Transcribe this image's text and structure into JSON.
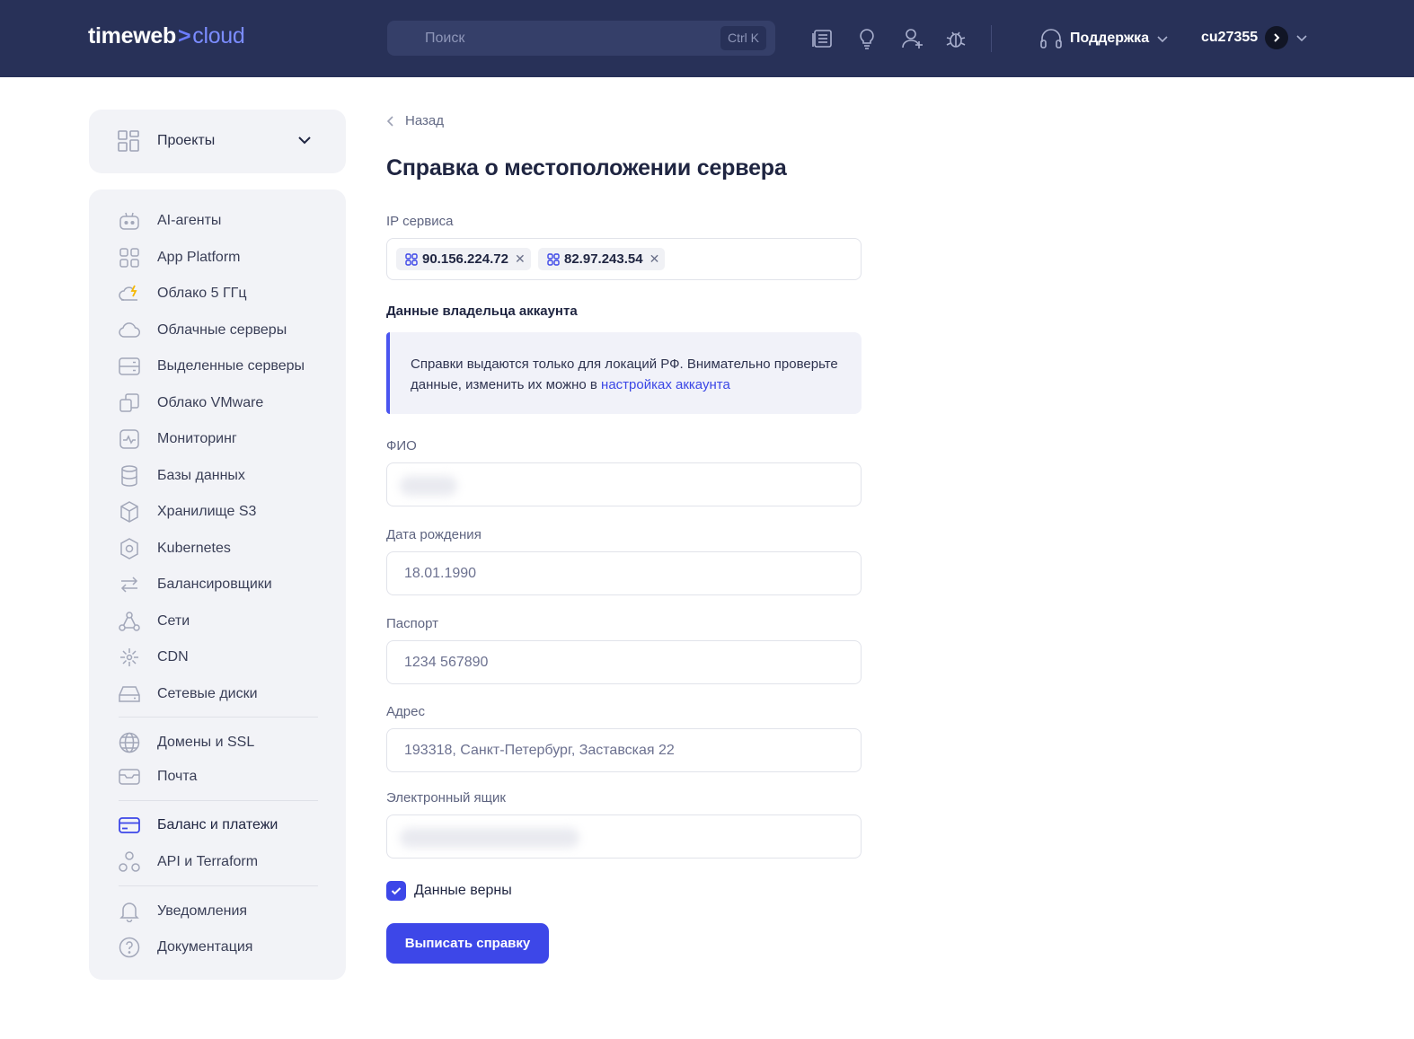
{
  "header": {
    "logo_main": "timeweb",
    "logo_arrow": ">",
    "logo_accent": "cloud",
    "search_placeholder": "Поиск",
    "search_shortcut": "Ctrl K",
    "icons": [
      "news-icon",
      "lightbulb-icon",
      "add-user-icon",
      "bug-icon"
    ],
    "support_label": "Поддержка",
    "user_name": "cu27355"
  },
  "sidebar": {
    "projects_label": "Проекты",
    "items": [
      {
        "label": "AI-агенты",
        "icon": "robot-icon"
      },
      {
        "label": "App Platform",
        "icon": "grid-icon"
      },
      {
        "label": "Облако 5 ГГц",
        "icon": "cloud-bolt-icon"
      },
      {
        "label": "Облачные серверы",
        "icon": "cloud-icon"
      },
      {
        "label": "Выделенные серверы",
        "icon": "server-icon"
      },
      {
        "label": "Облако VMware",
        "icon": "vmware-icon"
      },
      {
        "label": "Мониторинг",
        "icon": "monitoring-icon"
      },
      {
        "label": "Базы данных",
        "icon": "database-icon"
      },
      {
        "label": "Хранилище S3",
        "icon": "cube-icon"
      },
      {
        "label": "Kubernetes",
        "icon": "kubernetes-icon"
      },
      {
        "label": "Балансировщики",
        "icon": "balancer-icon"
      },
      {
        "label": "Сети",
        "icon": "network-icon"
      },
      {
        "label": "CDN",
        "icon": "cdn-icon"
      },
      {
        "label": "Сетевые диски",
        "icon": "disk-icon"
      },
      {
        "label": "Домены и SSL",
        "icon": "globe-icon"
      },
      {
        "label": "Почта",
        "icon": "mail-icon"
      },
      {
        "label": "Баланс и платежи",
        "icon": "card-icon"
      },
      {
        "label": "API и Terraform",
        "icon": "api-icon"
      },
      {
        "label": "Уведомления",
        "icon": "bell-icon"
      },
      {
        "label": "Документация",
        "icon": "help-icon"
      }
    ]
  },
  "main": {
    "back_label": "Назад",
    "title": "Справка о местоположении сервера",
    "ip_label": "IP сервиса",
    "ips": [
      "90.156.224.72",
      "82.97.243.54"
    ],
    "owner_section": "Данные владельца аккаунта",
    "notice_text": "Справки выдаются только для локаций РФ. Внимательно проверьте данные, изменить их можно в ",
    "notice_link": "настройках аккаунта",
    "fio_label": "ФИО",
    "birth_label": "Дата рождения",
    "birth_value": "18.01.1990",
    "passport_label": "Паспорт",
    "passport_value": "1234 567890",
    "address_label": "Адрес",
    "address_value": "193318, Санкт-Петербург, Заставская 22",
    "email_label": "Электронный ящик",
    "confirm_label": "Данные верны",
    "submit_label": "Выписать справку"
  },
  "colors": {
    "header_bg": "#283158",
    "accent": "#3d47e8",
    "sidebar_bg": "#f2f3f7"
  }
}
